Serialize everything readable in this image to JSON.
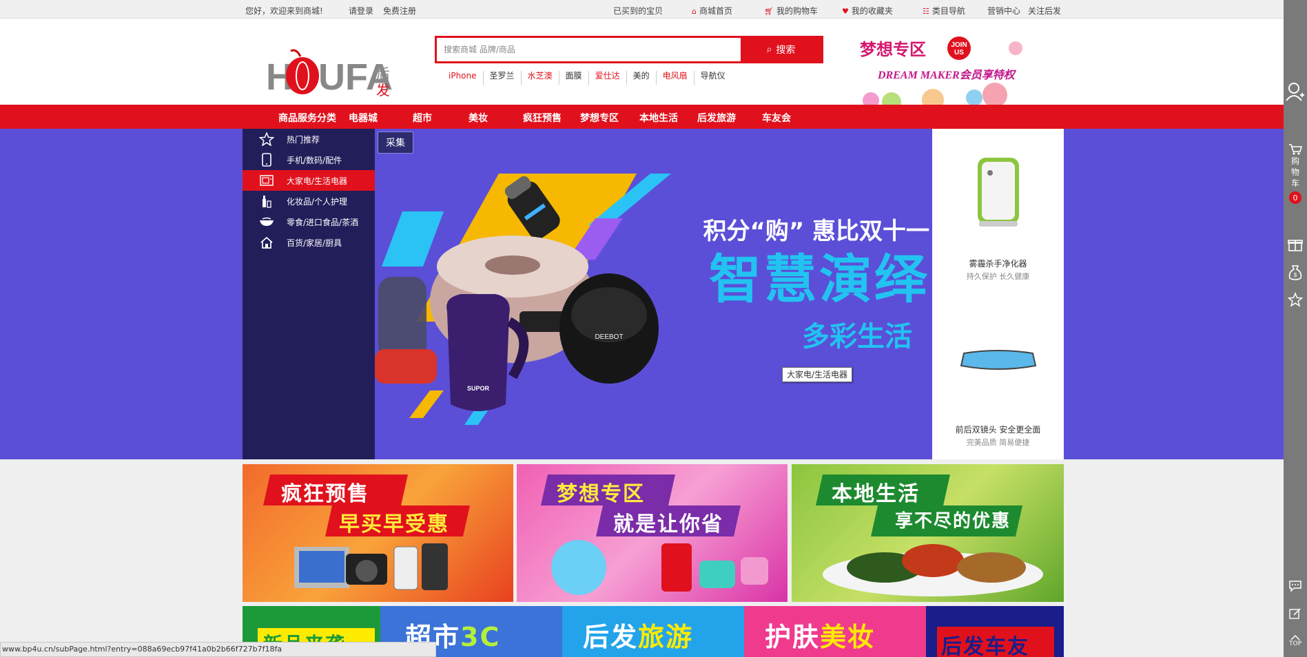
{
  "topbar": {
    "welcome": "您好，欢迎来到商城!",
    "login": "请登录",
    "register": "免费注册",
    "viewed": "已买到的宝贝",
    "home": "商城首页",
    "cart": "我的购物车",
    "favorites": "我的收藏夹",
    "category_nav": "类目导航",
    "marketing": "营销中心",
    "follow": "关注后发"
  },
  "logo": {
    "text": "HOUFA",
    "cn": "后发"
  },
  "search": {
    "placeholder": "搜索商城 品牌/商品",
    "button": "搜索",
    "hot_words": [
      {
        "label": "iPhone",
        "red": true
      },
      {
        "label": "圣罗兰",
        "red": false
      },
      {
        "label": "水芝澳",
        "red": true
      },
      {
        "label": "面膜",
        "red": false
      },
      {
        "label": "爱仕达",
        "red": true
      },
      {
        "label": "美的",
        "red": false
      },
      {
        "label": "电风扇",
        "red": true
      },
      {
        "label": "导航仪",
        "red": false
      }
    ]
  },
  "dream_banner": {
    "title": "梦想专区",
    "join": "JOIN US",
    "subtitle": "DREAM MAKER会员享特权"
  },
  "nav": {
    "items": [
      "商品服务分类",
      "电器城",
      "超市",
      "美妆",
      "疯狂预售",
      "梦想专区",
      "本地生活",
      "后发旅游",
      "车友会"
    ]
  },
  "categories": [
    {
      "label": "热门推荐",
      "icon": "star-icon",
      "active": false
    },
    {
      "label": "手机/数码/配件",
      "icon": "phone-icon",
      "active": false
    },
    {
      "label": "大家电/生活电器",
      "icon": "appliance-icon",
      "active": true
    },
    {
      "label": "化妆品/个人护理",
      "icon": "cosmetics-icon",
      "active": false
    },
    {
      "label": "零食/进口食品/茶酒",
      "icon": "bowl-icon",
      "active": false
    },
    {
      "label": "百货/家居/厨具",
      "icon": "home-icon",
      "active": false
    }
  ],
  "hero": {
    "collect": "采集",
    "line1": "积分“购” 惠比双十一",
    "line2": "智慧演绎",
    "line3": "多彩生活",
    "tooltip": "大家电/生活电器",
    "brand1": "SUPOR",
    "brand2": "DEEBOT"
  },
  "side_products": [
    {
      "title": "雾霾杀手净化器",
      "sub": "持久保护 长久健康"
    },
    {
      "title": "前后双镜头 安全更全面",
      "sub": "完美品质 简易便捷"
    }
  ],
  "promo_tiles": [
    {
      "line1": "疯狂预售",
      "line2": "早买早受惠"
    },
    {
      "line1": "梦想专区",
      "line2": "就是让你省"
    },
    {
      "line1": "本地生活",
      "line2": "享不尽的优惠"
    }
  ],
  "bottom_tiles": [
    {
      "a": "新品",
      "b": "来袭"
    },
    {
      "a": "超市",
      "b": "3C"
    },
    {
      "a": "后发",
      "b": "旅游"
    },
    {
      "a": "护肤",
      "b": "美妆"
    },
    {
      "a": "后发车友",
      "b": ""
    }
  ],
  "sidebar": {
    "cart_label": "购物车",
    "cart_count": "0",
    "top": "TOP"
  },
  "statusbar": {
    "url": "www.bp4u.cn/subPage.html?entry=088a69ecb97f41a0b2b66f727b7f18fa"
  },
  "colors": {
    "brand_red": "#e0111d",
    "hero_bg": "#5b4fd8",
    "menu_bg": "#221e5a"
  }
}
